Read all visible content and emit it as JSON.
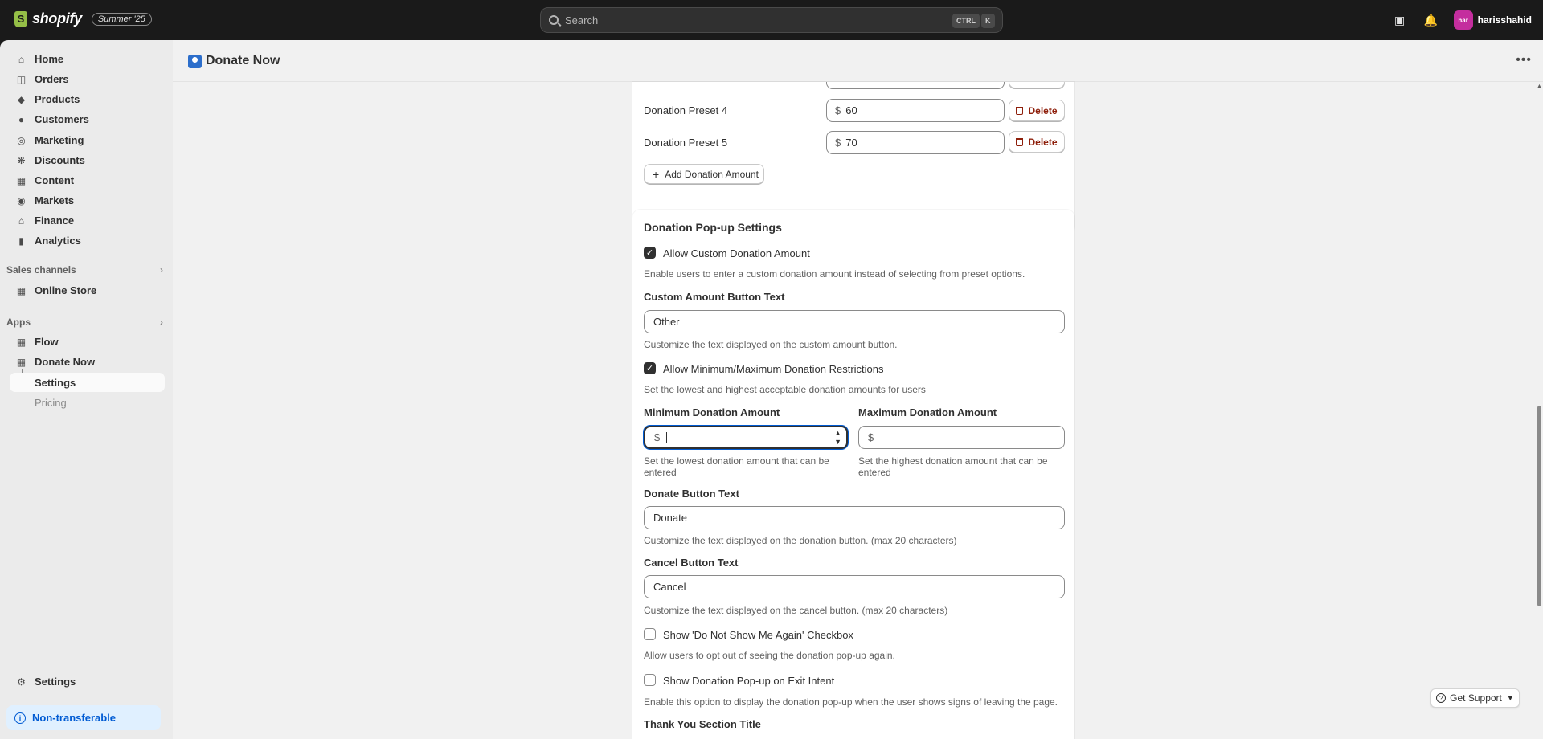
{
  "topbar": {
    "brand": "shopify",
    "edition": "Summer '25",
    "search_placeholder": "Search",
    "kbd_ctrl": "CTRL",
    "kbd_k": "K",
    "user_initials": "har",
    "user_name": "harisshahid"
  },
  "sidebar": {
    "items": [
      {
        "label": "Home",
        "icon": "home-icon"
      },
      {
        "label": "Orders",
        "icon": "orders-icon"
      },
      {
        "label": "Products",
        "icon": "tag-icon"
      },
      {
        "label": "Customers",
        "icon": "person-icon"
      },
      {
        "label": "Marketing",
        "icon": "target-icon"
      },
      {
        "label": "Discounts",
        "icon": "discount-icon"
      },
      {
        "label": "Content",
        "icon": "image-icon"
      },
      {
        "label": "Markets",
        "icon": "globe-icon"
      },
      {
        "label": "Finance",
        "icon": "bank-icon"
      },
      {
        "label": "Analytics",
        "icon": "chart-icon"
      }
    ],
    "sales_channels_label": "Sales channels",
    "online_store": "Online Store",
    "apps_label": "Apps",
    "flow": "Flow",
    "donate_now": "Donate Now",
    "settings_sub": "Settings",
    "pricing_sub": "Pricing",
    "settings": "Settings",
    "non_transferable": "Non-transferable"
  },
  "header": {
    "title": "Donate Now"
  },
  "presets": {
    "rows": [
      {
        "label": "Donation Preset 4",
        "currency": "$",
        "value": "60",
        "delete": "Delete"
      },
      {
        "label": "Donation Preset 5",
        "currency": "$",
        "value": "70",
        "delete": "Delete"
      }
    ],
    "add_button": "Add Donation Amount"
  },
  "popup": {
    "title": "Donation Pop-up Settings",
    "allow_custom": {
      "label": "Allow Custom Donation Amount",
      "checked": true,
      "help": "Enable users to enter a custom donation amount instead of selecting from preset options."
    },
    "custom_text": {
      "label": "Custom Amount Button Text",
      "value": "Other",
      "help": "Customize the text displayed on the custom amount button."
    },
    "allow_minmax": {
      "label": "Allow Minimum/Maximum Donation Restrictions",
      "checked": true,
      "help": "Set the lowest and highest acceptable donation amounts for users"
    },
    "min": {
      "label": "Minimum Donation Amount",
      "currency": "$",
      "value": "",
      "help": "Set the lowest donation amount that can be entered"
    },
    "max": {
      "label": "Maximum Donation Amount",
      "currency": "$",
      "value": "",
      "help": "Set the highest donation amount that can be entered"
    },
    "donate_text": {
      "label": "Donate Button Text",
      "value": "Donate",
      "help": "Customize the text displayed on the donation button. (max 20 characters)"
    },
    "cancel_text": {
      "label": "Cancel Button Text",
      "value": "Cancel",
      "help": "Customize the text displayed on the cancel button. (max 20 characters)"
    },
    "dont_show": {
      "label": "Show 'Do Not Show Me Again' Checkbox",
      "checked": false,
      "help": "Allow users to opt out of seeing the donation pop-up again."
    },
    "exit_intent": {
      "label": "Show Donation Pop-up on Exit Intent",
      "checked": false,
      "help": "Enable this option to display the donation pop-up when the user shows signs of leaving the page."
    },
    "thank_you_label": "Thank You Section Title"
  },
  "support": {
    "label": "Get Support"
  }
}
